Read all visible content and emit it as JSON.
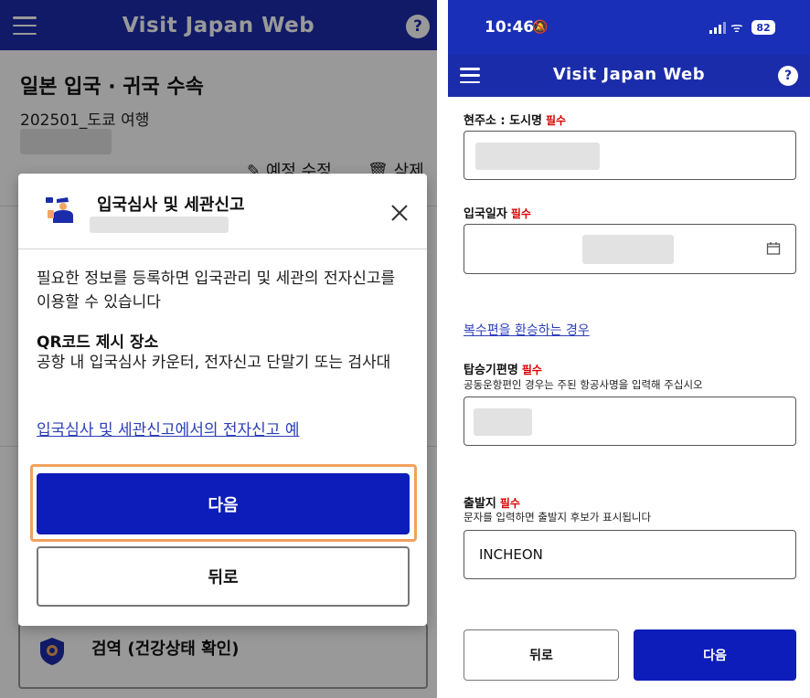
{
  "left": {
    "header": {
      "title": "Visit Japan Web",
      "help": "?"
    },
    "page_title": "일본 입국 · 귀국 수속",
    "trip_name": "202501_도쿄 여행",
    "actions": {
      "edit": "예정 수정",
      "delete": "삭제"
    },
    "bottom_card_label": "검역 (건강상태 확인)",
    "modal": {
      "title": "입국심사 및 세관신고",
      "description": "필요한 정보를 등록하면 입국관리 및 세관의 전자신고를 이용할 수 있습니다",
      "qr_heading": "QR코드 제시 장소",
      "qr_text": "공항 내 입국심사 카운터, 전자신고 단말기 또는 검사대",
      "link": "입국심사 및 세관신고에서의 전자신고 예",
      "next_button": "다음",
      "back_button": "뒤로"
    }
  },
  "right": {
    "status_bar": {
      "time": "10:46",
      "battery": "82"
    },
    "header": {
      "title": "Visit Japan Web",
      "help": "?"
    },
    "fields": {
      "city": {
        "label": "현주소 : 도시명",
        "required": "필수"
      },
      "entry_date": {
        "label": "입국일자",
        "required": "필수"
      },
      "multi_flight_link": "복수편을 환승하는 경우",
      "flight_name": {
        "label": "탑승기편명",
        "required": "필수",
        "help": "공동운항편인 경우는 주된 항공사명을 입력해 주십시오"
      },
      "departure": {
        "label": "출발지",
        "required": "필수",
        "help": "문자를 입력하면 출발지 후보가 표시됩니다",
        "value": "INCHEON"
      }
    },
    "back_button": "뒤로",
    "next_button": "다음"
  }
}
